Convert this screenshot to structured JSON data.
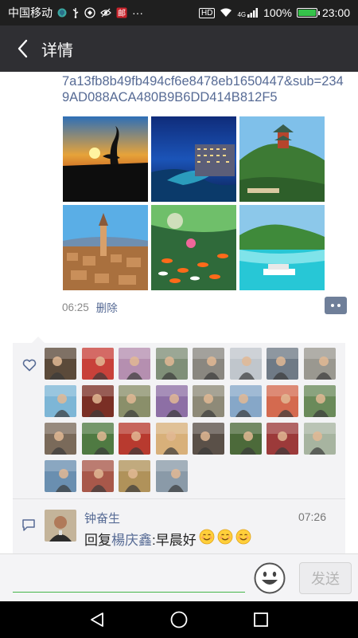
{
  "status_bar": {
    "carrier": "中国移动",
    "network": "4G",
    "hd": "HD",
    "battery_percent": "100%",
    "battery_level": 1.0,
    "time": "23:00",
    "more": "···"
  },
  "header": {
    "title": "详情",
    "back_icon": "chevron-left-icon"
  },
  "post": {
    "link_text": "7a13fb8b49fb494cf6e8478eb1650447&sub=2349AD088ACA480B9B6DD414B812F5",
    "photos": [
      {
        "name": "sunset-crane"
      },
      {
        "name": "night-coast-buildings"
      },
      {
        "name": "pagoda-hill"
      },
      {
        "name": "old-town-tower"
      },
      {
        "name": "koi-pond"
      },
      {
        "name": "tropical-island-boat"
      }
    ],
    "time": "06:25",
    "delete_label": "删除"
  },
  "likes": {
    "icon": "heart-icon",
    "avatar_count": 28,
    "avatar_colors": [
      "#5b4a3a",
      "#c8413a",
      "#b58fb0",
      "#7f8f78",
      "#8a8780",
      "#c0c6cc",
      "#6f7a86",
      "#9a9890",
      "#7db6d6",
      "#7a2f25",
      "#8a8f6a",
      "#8d6fa5",
      "#8e8a78",
      "#86a7c8",
      "#d46a4f",
      "#6a8a5a",
      "#7a6a5a",
      "#4f7a42",
      "#b83a2f",
      "#d8b07a",
      "#5a5048",
      "#4c6a3a",
      "#9c3a3a",
      "#a7b4a0",
      "#6a8fb0",
      "#a8584a",
      "#b0925a",
      "#8a9aa8"
    ]
  },
  "comment": {
    "icon": "comment-icon",
    "author": "钟奋生",
    "time": "07:26",
    "reply_prefix": "回复",
    "reply_to": "楊庆鑫",
    "text": ":早晨好",
    "emoji_count": 3
  },
  "input_bar": {
    "placeholder": "",
    "emoji_icon": "smiley-icon",
    "send_label": "发送"
  },
  "nav_bar": {
    "back": "triangle-back-icon",
    "home": "circle-home-icon",
    "recent": "square-recent-icon"
  }
}
